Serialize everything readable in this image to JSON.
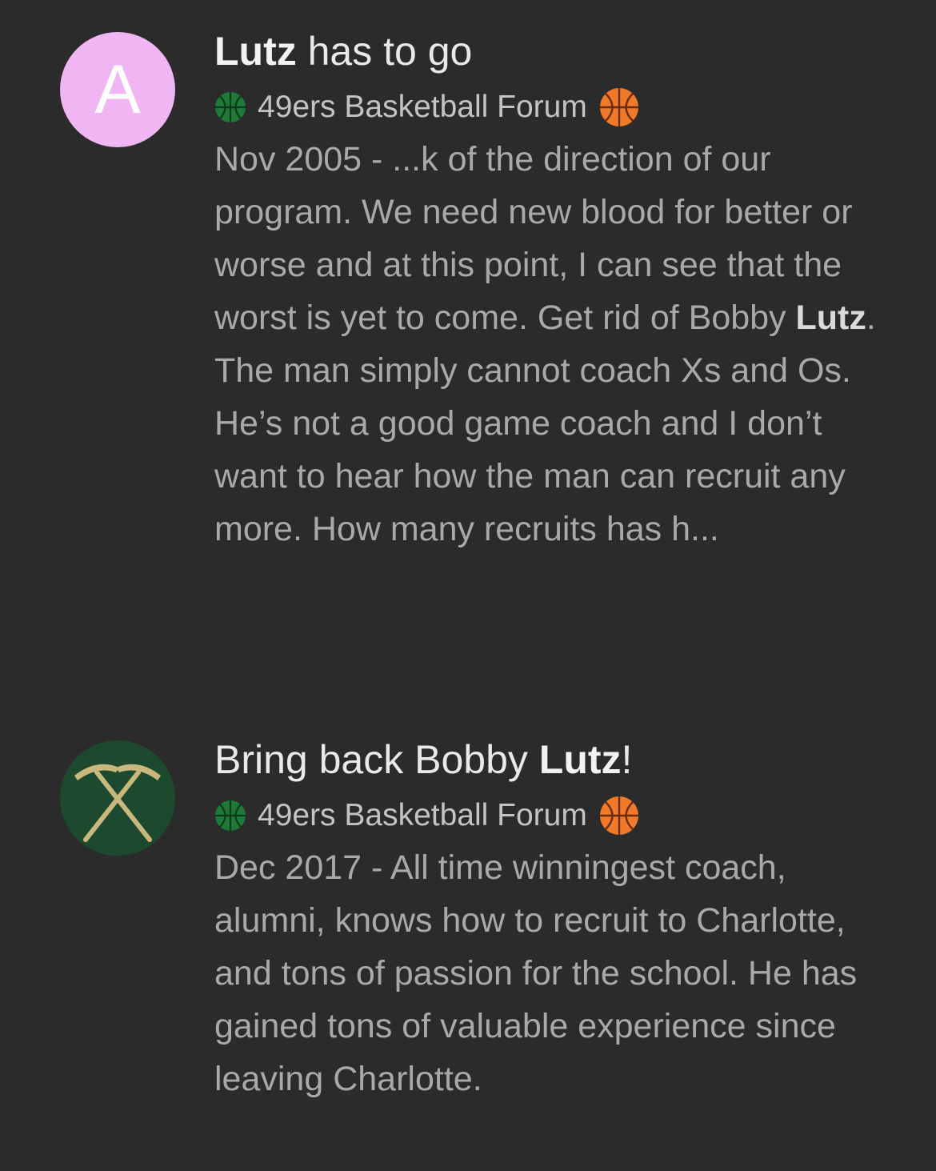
{
  "results": [
    {
      "avatar_letter": "A",
      "avatar_color": "#efb6f3",
      "title_pre": "",
      "title_highlight": "Lutz",
      "title_post": " has to go",
      "source": "49ers Basketball Forum",
      "favicon_icon": "green-basketball-icon",
      "emoji_icon": "basketball-emoji",
      "snippet_pre": "Nov 2005 - ...k of the direction of our program. We need new blood for better or worse and at this point, I can see that the worst is yet to come. Get rid of Bobby ",
      "snippet_highlight": "Lutz",
      "snippet_post": ". The man simply cannot coach Xs and Os. He’s not a good game coach and I don’t want to hear how the man can recruit any more. How many recruits has h..."
    },
    {
      "avatar_icon": "crossed-pickaxes-icon",
      "avatar_color": "#1d4a2f",
      "title_pre": "Bring back Bobby ",
      "title_highlight": "Lutz",
      "title_post": "!",
      "source": "49ers Basketball Forum",
      "favicon_icon": "green-basketball-icon",
      "emoji_icon": "basketball-emoji",
      "snippet": "Dec 2017 - All time winningest coach, alumni, knows how to recruit to Charlotte, and tons of passion for the school. He has gained tons of valuable experience since leaving Charlotte."
    }
  ],
  "colors": {
    "background": "#2b2b2c",
    "title": "#e9e9e9",
    "source": "#c4c4c4",
    "snippet": "#a9a9a9",
    "forum_green": "#1f7a3a",
    "ball_orange": "#f07a2a"
  }
}
